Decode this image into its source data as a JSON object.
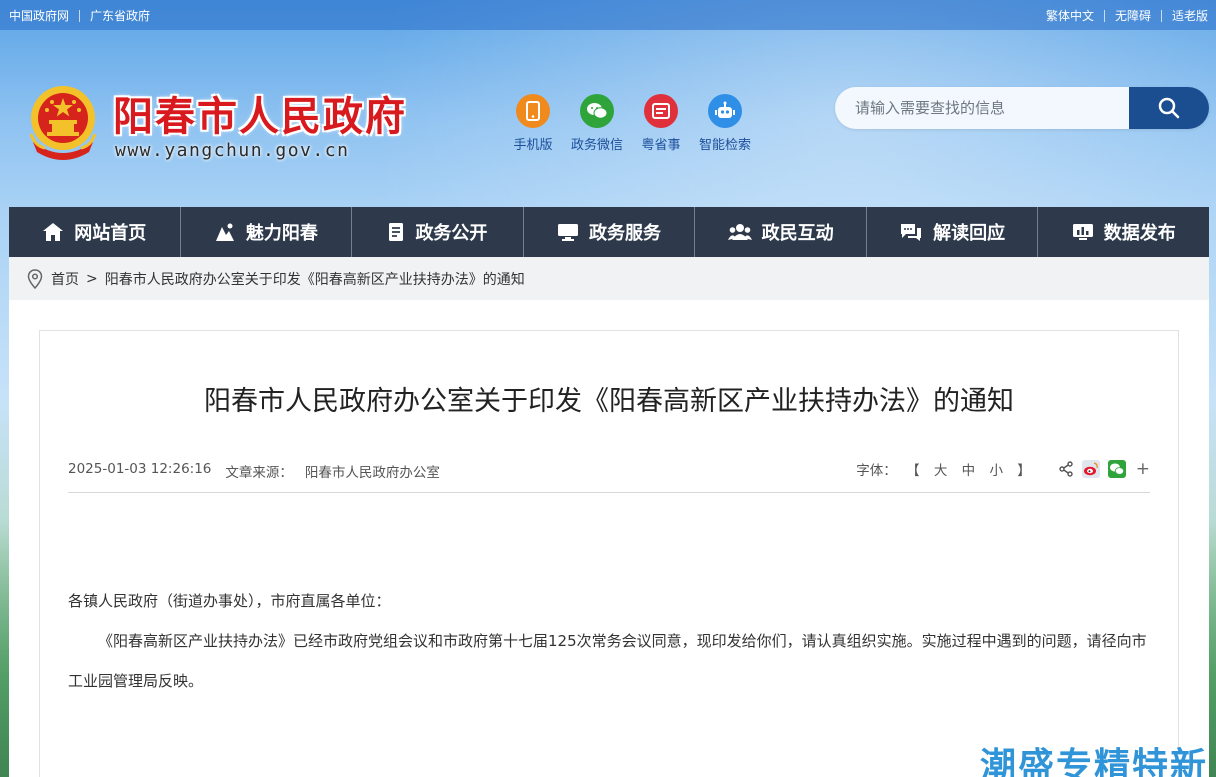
{
  "topbar": {
    "left": [
      "中国政府网",
      "广东省政府"
    ],
    "right": [
      "繁体中文",
      "无障碍",
      "适老版"
    ]
  },
  "header": {
    "title": "阳春市人民政府",
    "url": "www.yangchun.gov.cn"
  },
  "quick_links": [
    {
      "label": "手机版",
      "icon": "mobile-icon",
      "color": "#f08a1c"
    },
    {
      "label": "政务微信",
      "icon": "wechat-icon",
      "color": "#2ea43b"
    },
    {
      "label": "粤省事",
      "icon": "yueshengshi-icon",
      "color": "#e0303c"
    },
    {
      "label": "智能检索",
      "icon": "robot-icon",
      "color": "#2f8ee6"
    }
  ],
  "search": {
    "placeholder": "请输入需要查找的信息"
  },
  "nav": [
    {
      "label": "网站首页",
      "icon": "home-icon"
    },
    {
      "label": "魅力阳春",
      "icon": "scenery-icon"
    },
    {
      "label": "政务公开",
      "icon": "document-icon"
    },
    {
      "label": "政务服务",
      "icon": "monitor-icon"
    },
    {
      "label": "政民互动",
      "icon": "people-icon"
    },
    {
      "label": "解读回应",
      "icon": "chat-icon"
    },
    {
      "label": "数据发布",
      "icon": "data-icon"
    }
  ],
  "breadcrumb": {
    "home": "首页",
    "sep": ">",
    "current": "阳春市人民政府办公室关于印发《阳春高新区产业扶持办法》的通知"
  },
  "article": {
    "title": "阳春市人民政府办公室关于印发《阳春高新区产业扶持办法》的通知",
    "date": "2025-01-03 12:26:16",
    "source_label": "文章来源：",
    "source": "阳春市人民政府办公室",
    "font_label": "字体：",
    "font_open": "【",
    "font_large": "大",
    "font_medium": "中",
    "font_small": "小",
    "font_close": "】",
    "more": "+",
    "salutation": "各镇人民政府（街道办事处），市府直属各单位：",
    "paragraph": "《阳春高新区产业扶持办法》已经市政府党组会议和市政府第十七届125次常务会议同意，现印发给你们，请认真组织实施。实施过程中遇到的问题，请径向市工业园管理局反映。"
  },
  "watermark": "潮盛专精特新",
  "colors": {
    "title_red": "#d8191d",
    "nav_bg": "#2e3a4b",
    "search_btn": "#1a4e90",
    "link_blue": "#1c4e9a"
  }
}
